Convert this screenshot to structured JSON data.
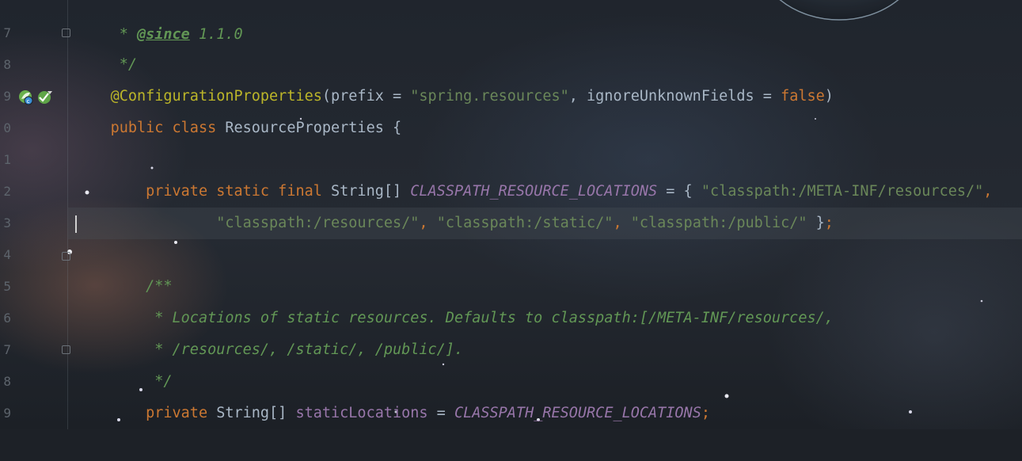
{
  "editor": {
    "gutter": {
      "line_numbers": [
        "7",
        "8",
        "9",
        "0",
        "1",
        "2",
        "3",
        "4",
        "5",
        "6",
        "7",
        "8",
        "9"
      ]
    },
    "lines": {
      "l0": {
        "star": " * ",
        "tag": "@since",
        "rest": " 1.1.0"
      },
      "l1": {
        "text": " */"
      },
      "l2": {
        "annotation": "@ConfigurationProperties",
        "p1": "(prefix = ",
        "s1": "\"spring.resources\"",
        "p2": ", ignoreUnknownFields = ",
        "kw": "false",
        "p3": ")"
      },
      "l3": {
        "kw": "public class ",
        "name": "ResourceProperties {"
      },
      "l5": {
        "kw": "    private static final ",
        "type": "String[] ",
        "const": "CLASSPATH_RESOURCE_LOCATIONS",
        "p1": " = { ",
        "s1": "\"classpath:/META-INF/resources/\"",
        "p2": ","
      },
      "l6": {
        "indent": "            ",
        "s1": "\"classpath:/resources/\"",
        "c1": ", ",
        "s2": "\"classpath:/static/\"",
        "c2": ", ",
        "s3": "\"classpath:/public/\"",
        "p1": " }",
        "semi": ";"
      },
      "l8": {
        "text": "    /**"
      },
      "l9": {
        "text": "     * Locations of static resources. Defaults to classpath:[/META-INF/resources/,"
      },
      "l10": {
        "text": "     * /resources/, /static/, /public/]."
      },
      "l11": {
        "text": "     */"
      },
      "l12": {
        "kw": "    private ",
        "type": "String[] ",
        "field": "staticLocations",
        "p1": " = ",
        "const": "CLASSPATH_RESOURCE_LOCATIONS",
        "semi": ";"
      }
    }
  },
  "colors": {
    "keyword": "#cc7832",
    "string": "#6a8759",
    "annotation": "#bbb529",
    "constant": "#9876aa",
    "doc_comment": "#629755",
    "text": "#a9b7c6"
  },
  "icons": [
    "fold-marker-icon",
    "spring-bean-icon",
    "class-implements-icon"
  ]
}
